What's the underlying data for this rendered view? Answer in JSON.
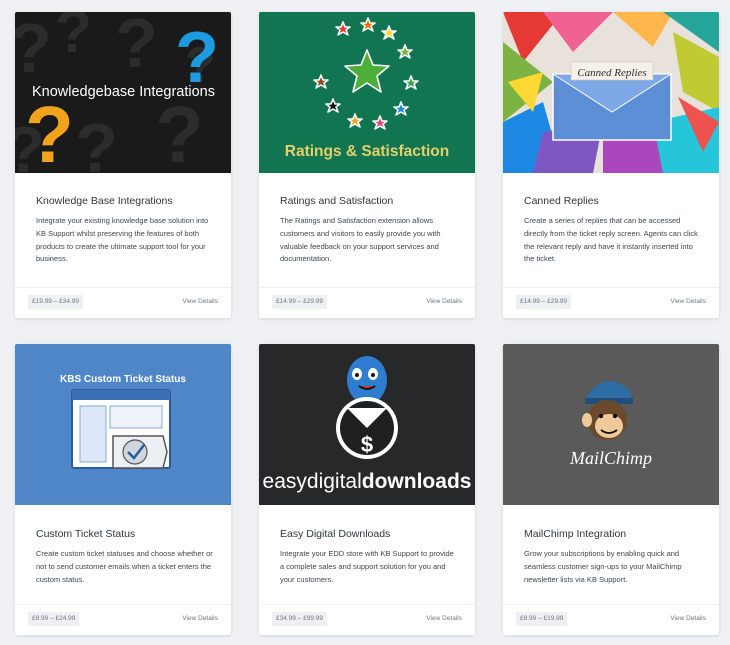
{
  "cards": [
    {
      "image_text": "Knowledgebase Integrations",
      "title": "Knowledge Base Integrations",
      "description": "Integrate your existing knowledge base solution into KB Support whilst preserving the features of both products to create the ultimate support tool for your business.",
      "price": "£19.99 – £34.99",
      "link": "View Details"
    },
    {
      "image_text": "Ratings & Satisfaction",
      "title": "Ratings and Satisfaction",
      "description": "The Ratings and Satisfaction extension allows customers and visitors to easily provide you with valuable feedback on your support services and documentation.",
      "price": "£14.99 – £29.99",
      "link": "View Details"
    },
    {
      "image_text": "Canned Replies",
      "title": "Canned Replies",
      "description": "Create a series of replies that can be accessed directly from the ticket reply screen. Agents can click the relevant reply and have it instantly inserted into the ticket.",
      "price": "£14.99 – £29.99",
      "link": "View Details"
    },
    {
      "image_text": "KBS Custom Ticket Status",
      "title": "Custom Ticket Status",
      "description": "Create custom ticket statuses and choose whether or not to send customer emails when a ticket enters the custom status.",
      "price": "£9.99 – £24.99",
      "link": "View Details"
    },
    {
      "image_text_parts": [
        "easy",
        "digital",
        "downloads"
      ],
      "title": "Easy Digital Downloads",
      "description": "Integrate your EDD store with KB Support to provide a complete sales and support solution for you and your customers.",
      "price": "£34.99 – £99.99",
      "link": "View Details"
    },
    {
      "image_text": "MailChimp",
      "title": "MailChimp Integration",
      "description": "Grow your subscriptions by enabling quick and seamless customer sign-ups to your MailChimp newsletter lists via KB Support.",
      "price": "£9.99 – £19.99",
      "link": "View Details"
    }
  ],
  "colors": {
    "page_background": "#eef0f3",
    "ratings_green": "#117552",
    "ratings_text": "#e6d06a",
    "custom_status_blue": "#4f86c8",
    "edd_dark": "#26282a",
    "mailchimp_gray": "#5a5a5a"
  }
}
